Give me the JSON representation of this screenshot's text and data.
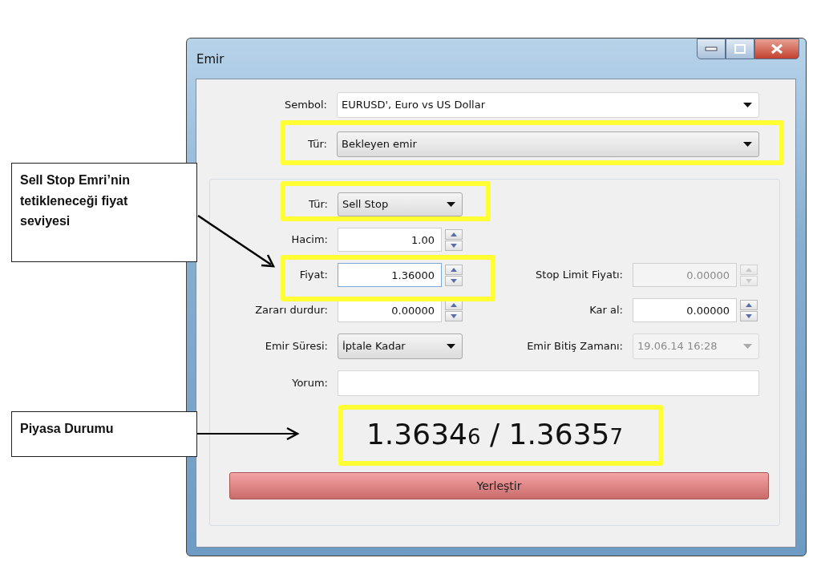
{
  "window": {
    "title": "Emir"
  },
  "symbol": {
    "label": "Sembol:",
    "value": "EURUSD', Euro vs US Dollar"
  },
  "type": {
    "label": "Tür:",
    "value": "Bekleyen emir"
  },
  "order_type": {
    "label": "Tür:",
    "value": "Sell Stop"
  },
  "rows": [
    {
      "left": {
        "kind": "spin",
        "label": "Hacim:",
        "value": "1.00",
        "focused": false,
        "disabled": false
      }
    },
    {
      "left": {
        "kind": "spin",
        "label": "Fiyat:",
        "value": "1.36000",
        "focused": true,
        "disabled": false
      },
      "right": {
        "kind": "spin",
        "label": "Stop Limit Fiyatı:",
        "value": "0.00000",
        "focused": false,
        "disabled": true
      }
    },
    {
      "left": {
        "kind": "spin",
        "label": "Zararı durdur:",
        "value": "0.00000",
        "focused": false,
        "disabled": false
      },
      "right": {
        "kind": "spin",
        "label": "Kar al:",
        "value": "0.00000",
        "focused": false,
        "disabled": false
      }
    },
    {
      "left": {
        "kind": "dropdown",
        "label": "Emir Süresi:",
        "value": "İptale Kadar",
        "disabled": false
      },
      "right": {
        "kind": "dropdown",
        "label": "Emir Bitiş Zamanı:",
        "value": "19.06.14 16:28",
        "disabled": true
      }
    }
  ],
  "comment": {
    "label": "Yorum:"
  },
  "quote": "1.3634$_{6}$ / 1.3635$_{7}$",
  "submit": "Yerleştir",
  "annotations": [
    {
      "text": "Sell Stop Emri’nin tetikleneceği fiyat seviyesi"
    },
    {
      "text": "Piyasa Durumu"
    }
  ]
}
